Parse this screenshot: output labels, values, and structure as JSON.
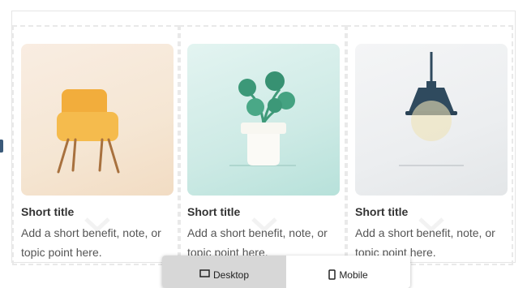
{
  "cards": [
    {
      "title": "Short title",
      "text": "Add a short benefit, note, or topic point here."
    },
    {
      "title": "Short title",
      "text": "Add a short benefit, note, or topic point here."
    },
    {
      "title": "Short title",
      "text": "Add a short benefit, note, or topic point here."
    }
  ],
  "view_toggle": {
    "options": [
      "Desktop",
      "Mobile"
    ],
    "selected": "Desktop"
  },
  "icons": {
    "card_1": "chair-illustration",
    "card_2": "potted-plant-illustration",
    "card_3": "pendant-lamp-illustration",
    "desktop": "desktop-icon",
    "mobile": "mobile-icon"
  }
}
